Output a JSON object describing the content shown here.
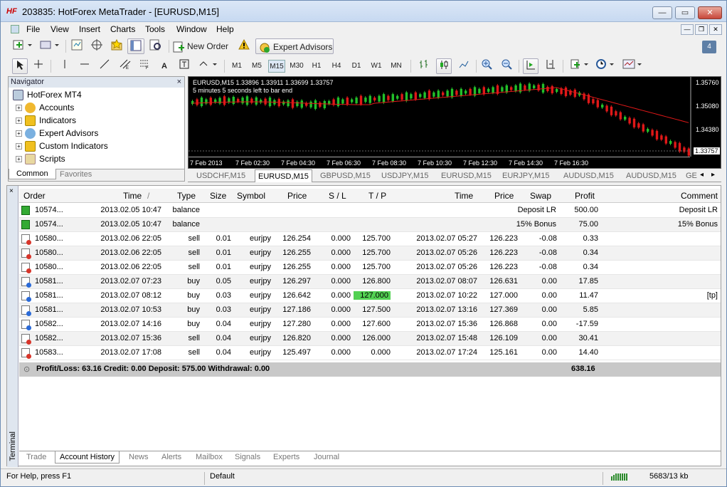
{
  "window": {
    "app_icon": "HF",
    "title": "203835: HotForex MetaTrader - [EURUSD,M15]",
    "btn_min": "—",
    "btn_max": "▭",
    "btn_close": "✕"
  },
  "menu": [
    "File",
    "View",
    "Insert",
    "Charts",
    "Tools",
    "Window",
    "Help"
  ],
  "toolbar": {
    "new_order": "New Order",
    "expert_advisors": "Expert Advisors",
    "notif_count": "4",
    "timeframes": [
      "M1",
      "M5",
      "M15",
      "M30",
      "H1",
      "H4",
      "D1",
      "W1",
      "MN"
    ],
    "active_timeframe": "M15"
  },
  "navigator": {
    "title": "Navigator",
    "close": "×",
    "root": "HotForex MT4",
    "items": [
      "Accounts",
      "Indicators",
      "Expert Advisors",
      "Custom Indicators",
      "Scripts"
    ],
    "tabs": [
      "Common",
      "Favorites"
    ]
  },
  "chart": {
    "header": "EURUSD,M15  1.33896 1.33911 1.33699 1.33757",
    "subheader": "5 minutes 5 seconds left to bar end",
    "price_labels": [
      "1.35760",
      "1.35080",
      "1.34380",
      "1.33757"
    ],
    "time_labels": [
      "7 Feb 2013",
      "7 Feb 02:30",
      "7 Feb 04:30",
      "7 Feb 06:30",
      "7 Feb 08:30",
      "7 Feb 10:30",
      "7 Feb 12:30",
      "7 Feb 14:30",
      "7 Feb 16:30"
    ],
    "tabs": [
      "USDCHF,M15",
      "EURUSD,M15",
      "GBPUSD,M15",
      "USDJPY,M15",
      "EURUSD,M15",
      "EURJPY,M15",
      "AUDUSD,M15",
      "AUDUSD,M15",
      "GE"
    ],
    "active_tab": "EURUSD,M15"
  },
  "terminal": {
    "label": "Terminal",
    "close": "×",
    "columns": [
      "Order",
      "Time",
      "Type",
      "Size",
      "Symbol",
      "Price",
      "S / L",
      "T / P",
      "Time",
      "Price",
      "Swap",
      "Profit",
      "Comment"
    ],
    "sort_indicator": "/",
    "balance_rows": [
      {
        "order": "10574...",
        "time": "2013.02.05 10:47",
        "type": "balance",
        "note": "Deposit LR",
        "profit": "500.00",
        "comment": "Deposit LR"
      },
      {
        "order": "10574...",
        "time": "2013.02.05 10:47",
        "type": "balance",
        "note": "15% Bonus",
        "profit": "75.00",
        "comment": "15% Bonus"
      }
    ],
    "trade_rows": [
      {
        "order": "10580...",
        "time": "2013.02.06 22:05",
        "type": "sell",
        "size": "0.01",
        "symbol": "eurjpy",
        "price": "126.254",
        "sl": "0.000",
        "tp": "125.700",
        "ctime": "2013.02.07 05:27",
        "cprice": "126.223",
        "swap": "-0.08",
        "profit": "0.33",
        "comment": ""
      },
      {
        "order": "10580...",
        "time": "2013.02.06 22:05",
        "type": "sell",
        "size": "0.01",
        "symbol": "eurjpy",
        "price": "126.255",
        "sl": "0.000",
        "tp": "125.700",
        "ctime": "2013.02.07 05:26",
        "cprice": "126.223",
        "swap": "-0.08",
        "profit": "0.34",
        "comment": ""
      },
      {
        "order": "10580...",
        "time": "2013.02.06 22:05",
        "type": "sell",
        "size": "0.01",
        "symbol": "eurjpy",
        "price": "126.255",
        "sl": "0.000",
        "tp": "125.700",
        "ctime": "2013.02.07 05:26",
        "cprice": "126.223",
        "swap": "-0.08",
        "profit": "0.34",
        "comment": ""
      },
      {
        "order": "10581...",
        "time": "2013.02.07 07:23",
        "type": "buy",
        "size": "0.05",
        "symbol": "eurjpy",
        "price": "126.297",
        "sl": "0.000",
        "tp": "126.800",
        "ctime": "2013.02.07 08:07",
        "cprice": "126.631",
        "swap": "0.00",
        "profit": "17.85",
        "comment": ""
      },
      {
        "order": "10581...",
        "time": "2013.02.07 08:12",
        "type": "buy",
        "size": "0.03",
        "symbol": "eurjpy",
        "price": "126.642",
        "sl": "0.000",
        "tp": "127.000",
        "ctime": "2013.02.07 10:22",
        "cprice": "127.000",
        "swap": "0.00",
        "profit": "11.47",
        "comment": "[tp]"
      },
      {
        "order": "10581...",
        "time": "2013.02.07 10:53",
        "type": "buy",
        "size": "0.03",
        "symbol": "eurjpy",
        "price": "127.186",
        "sl": "0.000",
        "tp": "127.500",
        "ctime": "2013.02.07 13:16",
        "cprice": "127.369",
        "swap": "0.00",
        "profit": "5.85",
        "comment": ""
      },
      {
        "order": "10582...",
        "time": "2013.02.07 14:16",
        "type": "buy",
        "size": "0.04",
        "symbol": "eurjpy",
        "price": "127.280",
        "sl": "0.000",
        "tp": "127.600",
        "ctime": "2013.02.07 15:36",
        "cprice": "126.868",
        "swap": "0.00",
        "profit": "-17.59",
        "comment": ""
      },
      {
        "order": "10582...",
        "time": "2013.02.07 15:36",
        "type": "sell",
        "size": "0.04",
        "symbol": "eurjpy",
        "price": "126.820",
        "sl": "0.000",
        "tp": "126.000",
        "ctime": "2013.02.07 15:48",
        "cprice": "126.109",
        "swap": "0.00",
        "profit": "30.41",
        "comment": ""
      },
      {
        "order": "10583...",
        "time": "2013.02.07 17:08",
        "type": "sell",
        "size": "0.04",
        "symbol": "eurjpy",
        "price": "125.497",
        "sl": "0.000",
        "tp": "0.000",
        "ctime": "2013.02.07 17:24",
        "cprice": "125.161",
        "swap": "0.00",
        "profit": "14.40",
        "comment": ""
      }
    ],
    "summary": {
      "text": "Profit/Loss: 63.16  Credit: 0.00  Deposit: 575.00  Withdrawal: 0.00",
      "total": "638.16"
    },
    "tabs": [
      "Trade",
      "Account History",
      "News",
      "Alerts",
      "Mailbox",
      "Signals",
      "Experts",
      "Journal"
    ],
    "active_tab": "Account History"
  },
  "status": {
    "help": "For Help, press F1",
    "profile": "Default",
    "traffic": "5683/13 kb"
  },
  "colors": {
    "tp_highlight": "#52d152",
    "bull": "#22c02a",
    "bear": "#e01818",
    "ma": "#e01818"
  }
}
